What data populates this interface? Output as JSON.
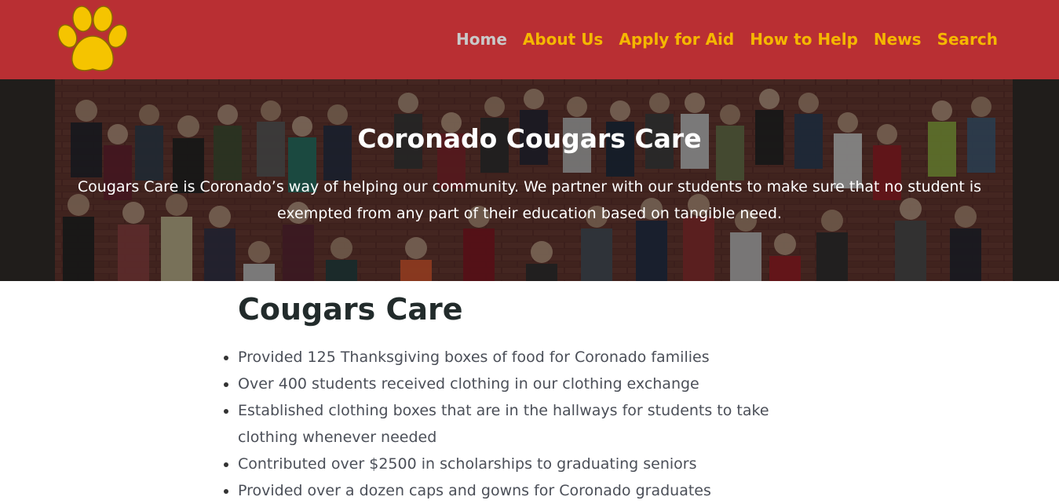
{
  "header": {
    "logo_name": "paw-icon",
    "colors": {
      "background": "#b92f33",
      "nav": "#f5b700",
      "nav_active": "#c9c9c9"
    },
    "nav": [
      {
        "label": "Home",
        "active": true
      },
      {
        "label": "About Us"
      },
      {
        "label": "Apply for Aid"
      },
      {
        "label": "How to Help"
      },
      {
        "label": "News"
      },
      {
        "label": "Search"
      }
    ]
  },
  "hero": {
    "title": "Coronado Cougars Care",
    "text": "Cougars Care is Coronado’s way of helping our community. We partner with our students to make sure that no student is exempted from any part of their education based on tangible need."
  },
  "main": {
    "heading": "Cougars Care",
    "bullets": [
      "Provided 125 Thanksgiving boxes of food for Coronado families",
      "Over 400 students received clothing in our clothing exchange",
      "Established clothing boxes that are in the hallways for students to take clothing whenever needed",
      "Contributed over $2500 in scholarships to graduating seniors",
      "Provided over a dozen caps and gowns for Coronado graduates"
    ]
  }
}
